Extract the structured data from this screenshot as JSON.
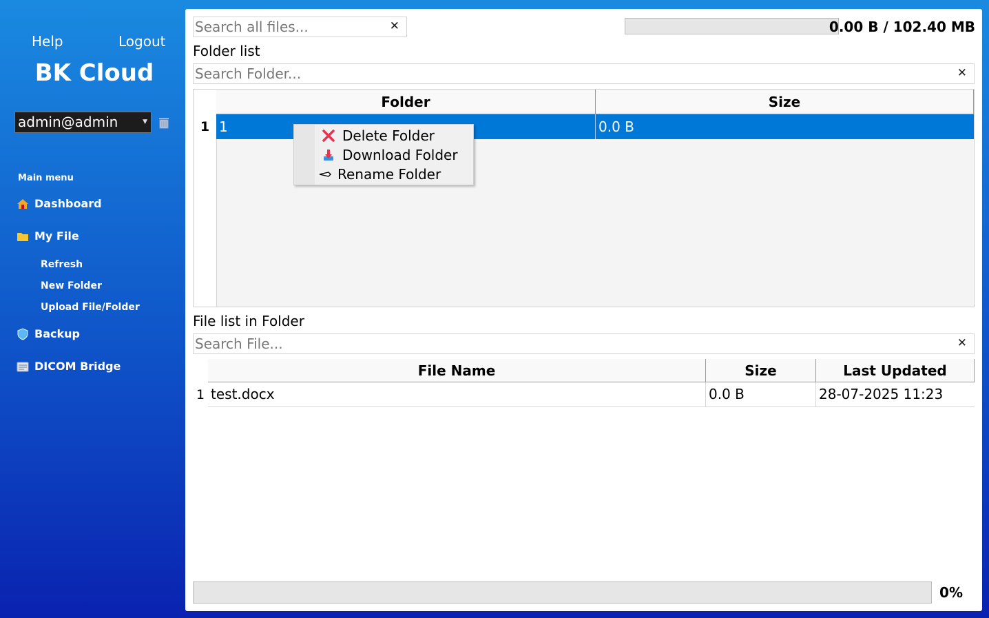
{
  "sidebar": {
    "help_label": "Help",
    "logout_label": "Logout",
    "app_title": "BK Cloud",
    "user": "admin@admin",
    "menu_heading": "Main menu",
    "items": {
      "dashboard": "Dashboard",
      "my_file": "My File",
      "refresh": "Refresh",
      "new_folder": "New Folder",
      "upload": "Upload File/Folder",
      "backup": "Backup",
      "dicom": "DICOM Bridge"
    }
  },
  "main": {
    "search_all_placeholder": "Search all files...",
    "storage_used_fraction": 0,
    "storage_usage": "0.00 B / 102.40 MB",
    "folder_list_label": "Folder list",
    "search_folder_placeholder": "Search Folder...",
    "folder_table": {
      "headers": {
        "folder": "Folder",
        "size": "Size"
      },
      "rows": [
        {
          "num": "1",
          "folder": "1",
          "size": "0.0 B"
        }
      ]
    },
    "context_menu": {
      "delete": "Delete Folder",
      "download": "Download Folder",
      "rename": "Rename Folder"
    },
    "file_list_label": "File list in Folder",
    "search_file_placeholder": "Search File...",
    "file_table": {
      "headers": {
        "name": "File Name",
        "size": "Size",
        "updated": "Last Updated"
      },
      "rows": [
        {
          "num": "1",
          "name": "test.docx",
          "size": "0.0 B",
          "updated": "28-07-2025 11:23"
        }
      ]
    },
    "progress_fraction": 0,
    "progress_label": "0%"
  },
  "colors": {
    "sidebar_top": "#1a8ae0",
    "sidebar_bottom": "#0a22b0",
    "selection": "#0078d7"
  }
}
